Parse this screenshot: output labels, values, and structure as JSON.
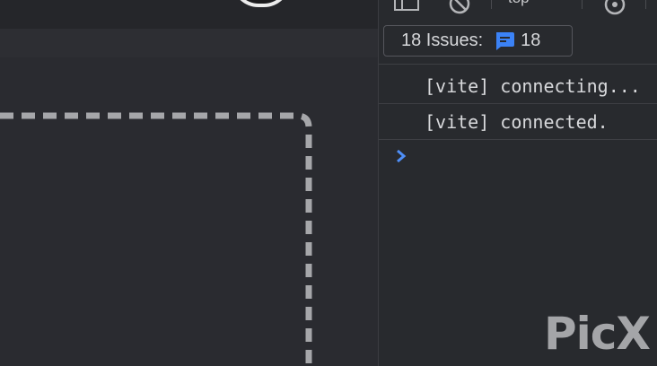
{
  "devtools": {
    "toolbar": {
      "context": "top",
      "icons": [
        "dock-icon",
        "clear-console-icon",
        "settings-icon"
      ]
    },
    "issues": {
      "label": "18 Issues:",
      "count": "18",
      "icon": "message-icon",
      "icon_color": "#3b82f6"
    },
    "console": {
      "messages": [
        "[vite] connecting...",
        "[vite] connected."
      ],
      "prompt_icon": "chevron-right-icon",
      "prompt_color": "#4f8ff7"
    },
    "watermark": "PicX"
  },
  "page": {
    "outline_color": "#a6a7aa"
  }
}
